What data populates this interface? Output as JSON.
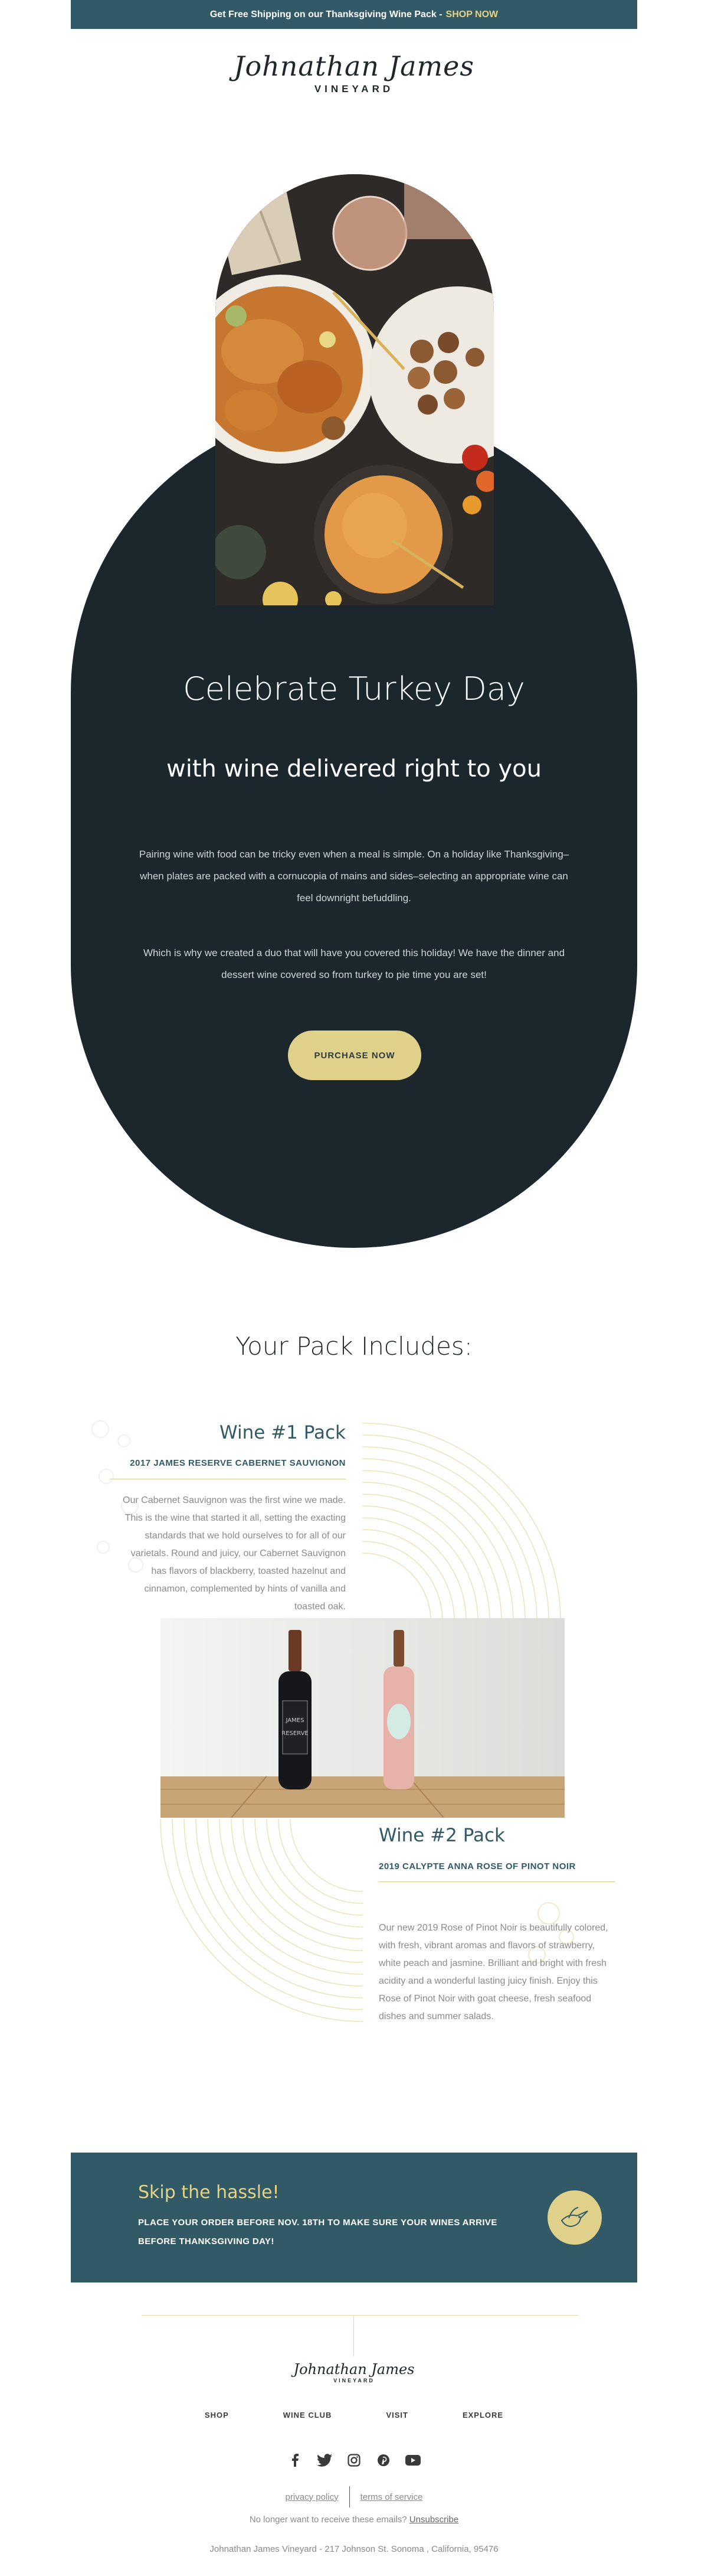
{
  "banner": {
    "text": "Get Free Shipping on our Thanksgiving Wine Pack - ",
    "cta": "SHOP NOW"
  },
  "logo": {
    "script": "Johnathan James",
    "sub": "VINEYARD"
  },
  "hero": {
    "title": "Celebrate Turkey Day",
    "subtitle": "with wine delivered right to you",
    "paragraph1": "Pairing wine with food can be tricky even when a meal is simple. On a holiday like Thanksgiving–when plates are packed with a cornucopia of mains and sides–selecting an appropriate wine can feel downright befuddling.",
    "paragraph2": "Which is why we created a duo that will have you covered this holiday! We have the dinner and dessert wine covered so from turkey to pie time you are set!",
    "button": "PURCHASE NOW"
  },
  "pack": {
    "heading": "Your Pack Includes:",
    "wines": [
      {
        "title": "Wine #1 Pack",
        "name": "2017 JAMES RESERVE CABERNET SAUVIGNON",
        "description": "Our Cabernet Sauvignon was the first wine we made. This is the wine that started it all, setting the exacting standards that we hold ourselves to for all of our varietals. Round and juicy, our Cabernet Sauvignon has flavors of blackberry, toasted hazelnut and cinnamon, complemented by hints of vanilla and toasted oak."
      },
      {
        "title": "Wine #2 Pack",
        "name": "2019 CALYPTE ANNA ROSE OF PINOT NOIR",
        "description": "Our new 2019 Rose of Pinot Noir is beautifully colored, with fresh, vibrant aromas and flavors of strawberry, white peach and jasmine. Brilliant and bright with fresh acidity and a wonderful lasting juicy finish. Enjoy this Rose of Pinot Noir with goat cheese, fresh seafood dishes and summer salads."
      }
    ],
    "bottle_labels": {
      "cab_top": "JAMES",
      "cab_bottom": "RESERVE"
    }
  },
  "hassle": {
    "title": "Skip the hassle!",
    "text": "PLACE YOUR ORDER BEFORE NOV. 18TH TO MAKE SURE YOUR WINES ARRIVE BEFORE THANKSGIVING DAY!"
  },
  "footer": {
    "logo_script": "Johnathan James",
    "logo_sub": "VINEYARD",
    "nav": [
      "SHOP",
      "WINE CLUB",
      "VISIT",
      "EXPLORE"
    ],
    "social": [
      "facebook-icon",
      "twitter-icon",
      "instagram-icon",
      "pinterest-icon",
      "youtube-icon"
    ],
    "privacy": "privacy policy",
    "terms": "terms of service",
    "unsub_text": "No longer want to receive these emails? ",
    "unsub_link": "Unsubscribe",
    "address": "Johnathan James Vineyard - 217 Johnson St. Sonoma , California, 95476"
  },
  "colors": {
    "teal": "#315966",
    "dark": "#1b272c",
    "gold": "#e0d18a"
  }
}
